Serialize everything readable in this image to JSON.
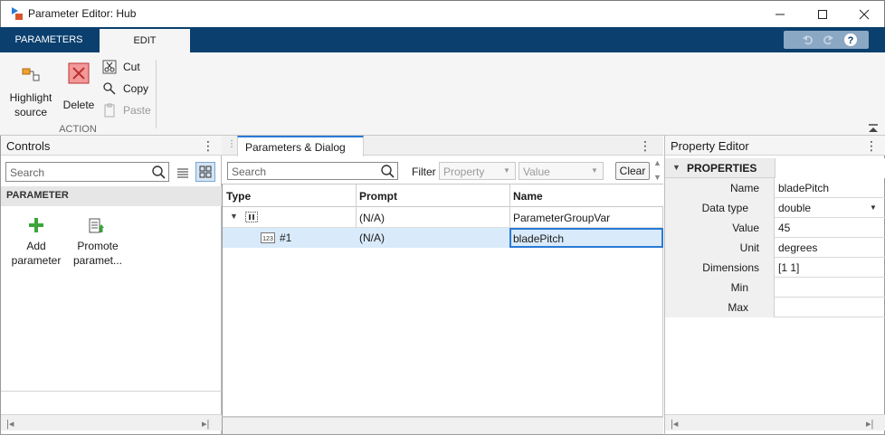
{
  "window": {
    "title": "Parameter Editor: Hub"
  },
  "tabs": [
    {
      "label": "PARAMETERS",
      "active": false
    },
    {
      "label": "EDIT",
      "active": true
    }
  ],
  "ribbon": {
    "highlight_label_1": "Highlight",
    "highlight_label_2": "source",
    "delete_label": "Delete",
    "cut_label": "Cut",
    "copy_label": "Copy",
    "paste_label": "Paste",
    "section_label": "ACTION"
  },
  "controls": {
    "title": "Controls",
    "search_placeholder": "Search",
    "section": "PARAMETER",
    "add_label_1": "Add",
    "add_label_2": "parameter",
    "promote_label_1": "Promote",
    "promote_label_2": "paramet..."
  },
  "params": {
    "tab_label": "Parameters & Dialog",
    "search_placeholder": "Search",
    "filter_label": "Filter",
    "filter_property": "Property",
    "filter_value": "Value",
    "clear_label": "Clear",
    "columns": [
      "Type",
      "Prompt",
      "Name"
    ],
    "rows": [
      {
        "type": "",
        "prompt": "(N/A)",
        "name": "ParameterGroupVar"
      },
      {
        "type": "#1",
        "prompt": "(N/A)",
        "name": "bladePitch"
      }
    ]
  },
  "property_editor": {
    "title": "Property Editor",
    "section": "PROPERTIES",
    "rows": [
      {
        "label": "Name",
        "value": "bladePitch"
      },
      {
        "label": "Data type",
        "value": "double"
      },
      {
        "label": "Value",
        "value": "45"
      },
      {
        "label": "Unit",
        "value": "degrees"
      },
      {
        "label": "Dimensions",
        "value": "[1 1]"
      },
      {
        "label": "Min",
        "value": ""
      },
      {
        "label": "Max",
        "value": ""
      }
    ]
  },
  "colors": {
    "tabstrip": "#0a3f6e",
    "selection": "#d9eafa",
    "selection_border": "#2a7ad5",
    "add_icon": "#3aa63a",
    "delete_icon": "#e05050"
  },
  "icons": [
    "app-icon",
    "minimize-icon",
    "maximize-icon",
    "close-icon",
    "undo-icon",
    "redo-icon",
    "help-icon",
    "highlight-icon",
    "delete-icon",
    "cut-icon",
    "copy-icon",
    "paste-icon",
    "collapse-ribbon-icon",
    "search-icon",
    "list-view-icon",
    "grid-view-icon",
    "add-icon",
    "promote-icon",
    "group-icon",
    "number-icon"
  ]
}
